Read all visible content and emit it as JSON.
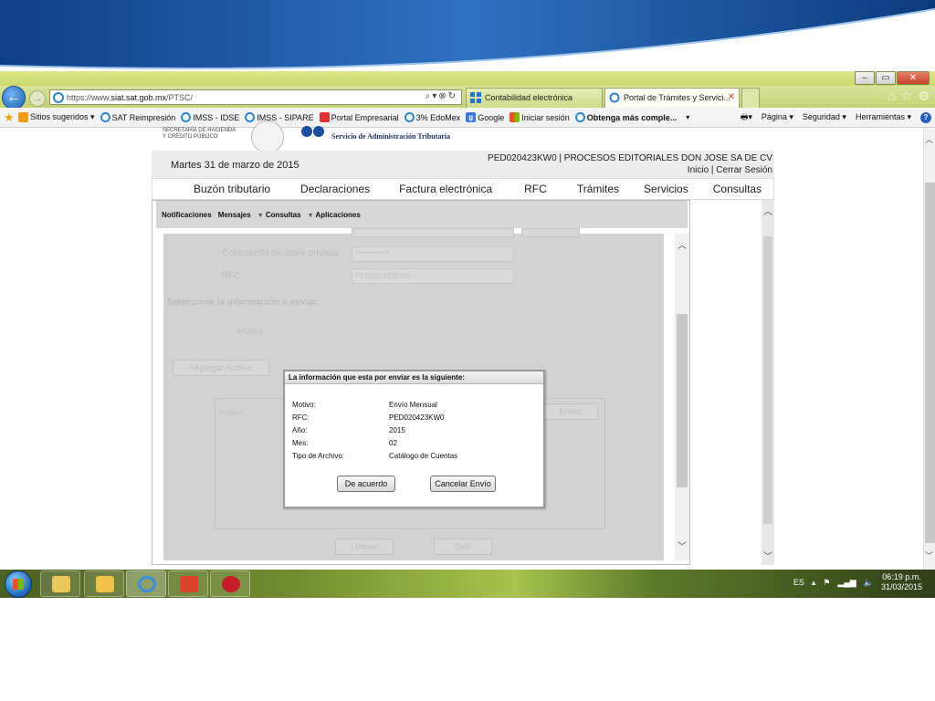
{
  "browser": {
    "url_prefix": "https://www.",
    "url_domain": "siat.sat.gob.mx",
    "url_path": "/PTSC/",
    "tabs": [
      {
        "label": "Contabilidad electrónica"
      },
      {
        "label": "Portal de Trámites y Servici..."
      }
    ]
  },
  "favorites": [
    {
      "label": "Sitios sugeridos ▾",
      "icon": "bing-icon"
    },
    {
      "label": "SAT Reimpresión",
      "icon": "ie-page-icon"
    },
    {
      "label": "IMSS - IDSE",
      "icon": "ie-page-icon"
    },
    {
      "label": "IMSS - SIPARE",
      "icon": "ie-page-icon"
    },
    {
      "label": "Portal Empresarial",
      "icon": "portal-icon"
    },
    {
      "label": "3% EdoMex",
      "icon": "ie-page-icon"
    },
    {
      "label": "Google",
      "icon": "google-icon"
    },
    {
      "label": "Iniciar sesión",
      "icon": "microsoft-icon"
    },
    {
      "label": "Obtenga más comple...",
      "icon": "ie-page-icon"
    }
  ],
  "favorites_tools": [
    "Página ▾",
    "Seguridad ▾",
    "Herramientas ▾"
  ],
  "header": {
    "agency_line1": "SECRETARÍA DE HACIENDA",
    "agency_line2": "Y CRÉDITO PÚBLICO",
    "service_name": "Servicio de Administración Tributaria"
  },
  "infobar": {
    "date": "Martes 31 de marzo de 2015",
    "rfc_company": "PED020423KW0 | PROCESOS EDITORIALES DON JOSE SA DE CV",
    "links": "Inicio | Cerrar Sesión"
  },
  "main_nav": [
    "Buzón tributario",
    "Declaraciones",
    "Factura electrónica",
    "RFC",
    "Trámites",
    "Servicios",
    "Consultas"
  ],
  "sub_nav": {
    "item1": "Notificaciones",
    "item2": "Mensajes",
    "item3": "Consultas",
    "item4": "Aplicaciones"
  },
  "form": {
    "private_key_password_label": "Contraseña de clave privada",
    "private_key_password_value": "************",
    "rfc_label": "RFC",
    "rfc_value": "PED020423KW0",
    "select_info_label": "Seleccione la información a enviar:",
    "motivo_label": "Motivo:",
    "add_file_button": "+Agregar Archivo",
    "send_button": "Enviar",
    "file_label": "Archivo",
    "clear_button": "Limpiar",
    "exit_button": "Salir"
  },
  "dialog": {
    "title": "La información que esta por enviar es la siguiente:",
    "rows": [
      {
        "label": "Motivo:",
        "value": "Envío Mensual"
      },
      {
        "label": "RFC:",
        "value": "PED020423KW0"
      },
      {
        "label": "Año:",
        "value": "2015"
      },
      {
        "label": "Mes:",
        "value": "02"
      },
      {
        "label": "Tipo de Archivo:",
        "value": "Catálogo de Cuentas"
      }
    ],
    "accept_button": "De acuerdo",
    "cancel_button": "Cancelar Envío"
  },
  "taskbar": {
    "language": "ES",
    "time": "06:19 p.m.",
    "date": "31/03/2015"
  },
  "colors": {
    "title_strip": "#c9d76a",
    "slide_header": "#1f5fa8",
    "sat_blue": "#1b4d9a"
  }
}
